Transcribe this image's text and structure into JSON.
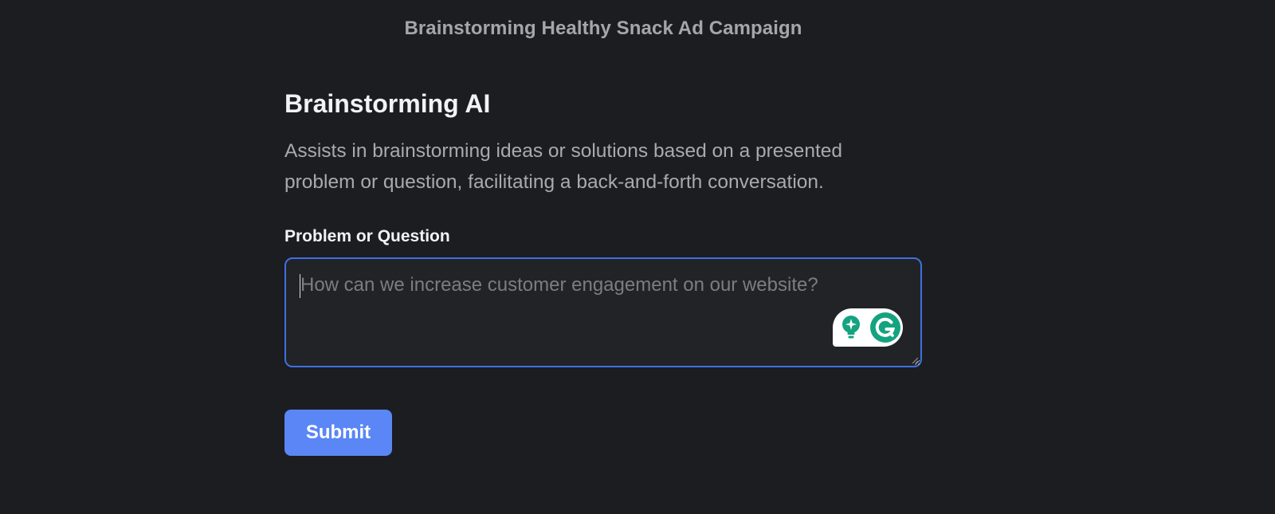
{
  "header": {
    "title": "Brainstorming Healthy Snack Ad Campaign"
  },
  "tool": {
    "title": "Brainstorming AI",
    "description": "Assists in brainstorming ideas or solutions based on a presented problem or question, facilitating a back-and-forth conversation."
  },
  "form": {
    "problem_label": "Problem or Question",
    "problem_value": "",
    "problem_placeholder": "How can we increase customer engagement on our website?",
    "submit_label": "Submit"
  },
  "extension": {
    "name": "grammarly",
    "icons": [
      "lightbulb-sparkle-icon",
      "grammarly-g-icon"
    ],
    "accent_color": "#15a37f"
  },
  "colors": {
    "background": "#1c1d21",
    "input_border_focus": "#3f6fe3",
    "submit_button": "#5a86f6"
  }
}
